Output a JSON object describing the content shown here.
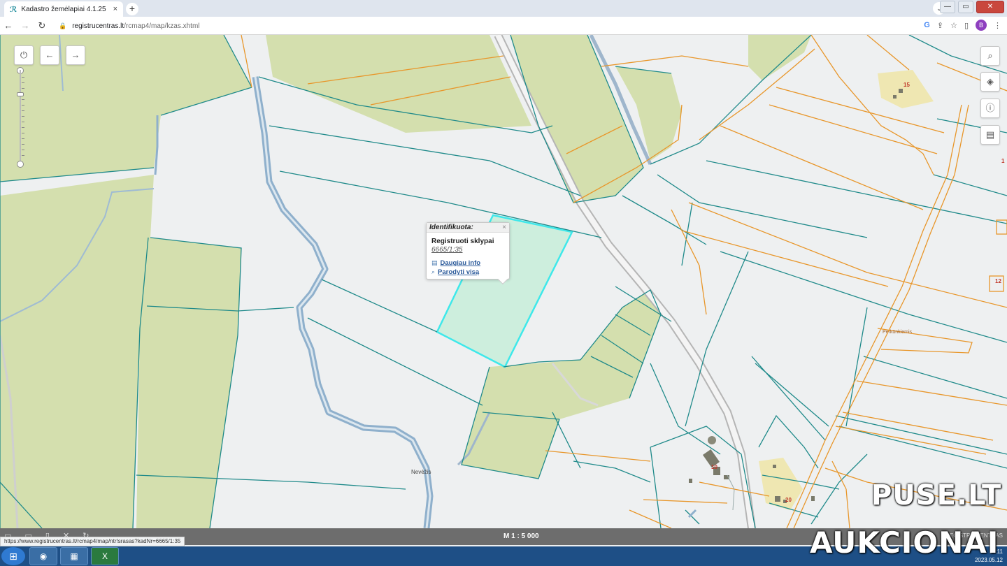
{
  "browser": {
    "tab_title": "Kadastro žemėlapiai 4.1.25",
    "tab_close": "×",
    "new_tab": "+",
    "url_host": "registrucentras.lt",
    "url_path": "/rcmap4/map/kzas.xhtml",
    "status_url": "https://www.registrucentras.lt/rcmap4/map/ntr!srasas?kadNr=6665/1:35",
    "profile_initial": "B",
    "tab_dropdown": "⌄",
    "google": "G",
    "share": "⇪",
    "star": "☆",
    "side_panel": "▯",
    "menu": "⋮",
    "minimize": "—",
    "maximize": "▭",
    "close": "✕",
    "back": "←",
    "forward": "→",
    "reload": "↻",
    "lock_icon": "🔒"
  },
  "map_controls": {
    "power": "⏻",
    "back": "←",
    "forward": "→",
    "search": "⌕",
    "layers": "◈",
    "info": "ⓘ",
    "document": "▤"
  },
  "popup": {
    "header": "Identifikuota:",
    "close": "×",
    "title": "Registruoti sklypai",
    "parcel_id": "6665/1:35",
    "more_info_icon": "▤",
    "more_info": "Daugiau info",
    "show_all_icon": "⌕",
    "show_all": "Parodyti visą"
  },
  "map_labels": {
    "river": "Nevėžis",
    "road": "Perkūnkiemis",
    "parcel_15": "15",
    "parcel_10": "10",
    "parcel_20": "20",
    "parcel_12": "12",
    "parcel_1": "1"
  },
  "footer": {
    "scale": "M 1 : 5 000",
    "left_icons": "▭ ▭ ▯ ✕ ↻",
    "right_text": "REGISTRŲ CENTRAS"
  },
  "taskbar": {
    "start": "⊞",
    "chrome": "◉",
    "explorer": "▦",
    "excel": "X",
    "time": "14:11",
    "date": "2023.05.12"
  },
  "watermark": {
    "line1": "PUSE.LT",
    "line2": "AUKCIONAI"
  },
  "colors": {
    "parcel_border": "#1f8a8a",
    "orange_border": "#e8962a",
    "forest_fill": "#d4dfae",
    "selected_fill": "#cdeedd",
    "selected_border": "#3ee8ea",
    "river": "#8fb0cc"
  }
}
